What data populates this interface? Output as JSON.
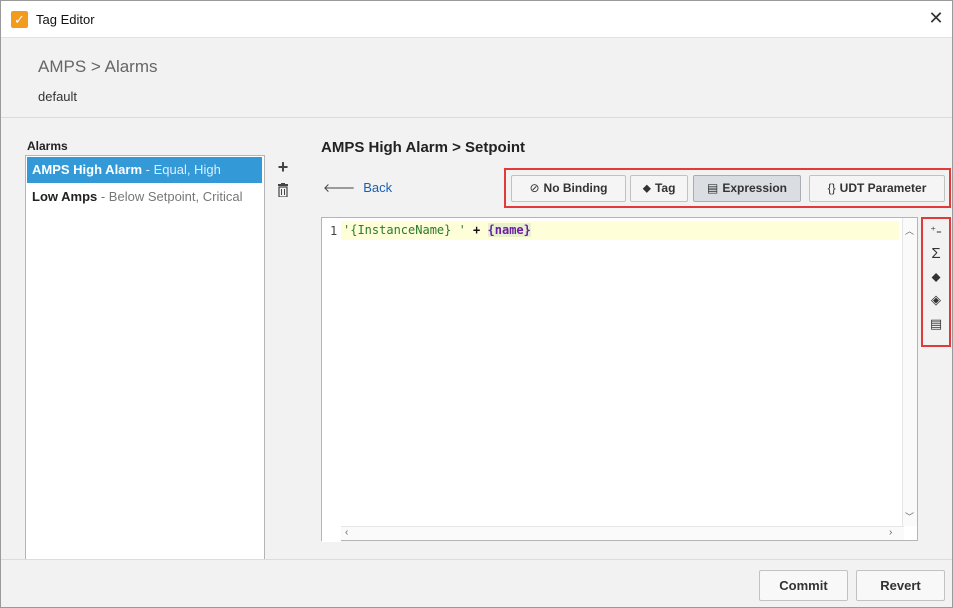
{
  "window": {
    "title": "Tag Editor",
    "close_icon": "close-icon"
  },
  "header": {
    "breadcrumb": "AMPS > Alarms",
    "provider": "default"
  },
  "alarms": {
    "label": "Alarms",
    "items": [
      {
        "name": "AMPS High Alarm",
        "desc": " - Equal, High",
        "selected": true
      },
      {
        "name": "Low Amps",
        "desc": " - Below Setpoint, Critical",
        "selected": false
      }
    ],
    "add_icon": "plus-icon",
    "delete_icon": "trash-icon"
  },
  "panel": {
    "title": "AMPS High Alarm > Setpoint",
    "back_label": "Back"
  },
  "binding": {
    "buttons": [
      {
        "icon": "⊘",
        "label": "No Binding",
        "active": false
      },
      {
        "icon": "⬥",
        "label": "Tag",
        "active": false
      },
      {
        "icon": "▤",
        "label": "Expression",
        "active": true
      },
      {
        "icon": "{}",
        "label": "UDT Parameter",
        "active": false
      }
    ]
  },
  "editor": {
    "line_number": "1",
    "code": {
      "str": "'{InstanceName} '",
      "op": " + ",
      "ref": "{name}"
    }
  },
  "tools": [
    {
      "name": "insert-operator-icon",
      "glyph": "⁺₌"
    },
    {
      "name": "function-sigma-icon",
      "glyph": "Σ"
    },
    {
      "name": "tag-icon",
      "glyph": "⬥"
    },
    {
      "name": "property-tag-icon",
      "glyph": "◈"
    },
    {
      "name": "expression-list-icon",
      "glyph": "▤"
    }
  ],
  "footer": {
    "commit_label": "Commit",
    "revert_label": "Revert"
  },
  "colors": {
    "selection": "#3399d7",
    "highlight_box": "#e03a3a",
    "app_icon": "#f39b1d"
  }
}
